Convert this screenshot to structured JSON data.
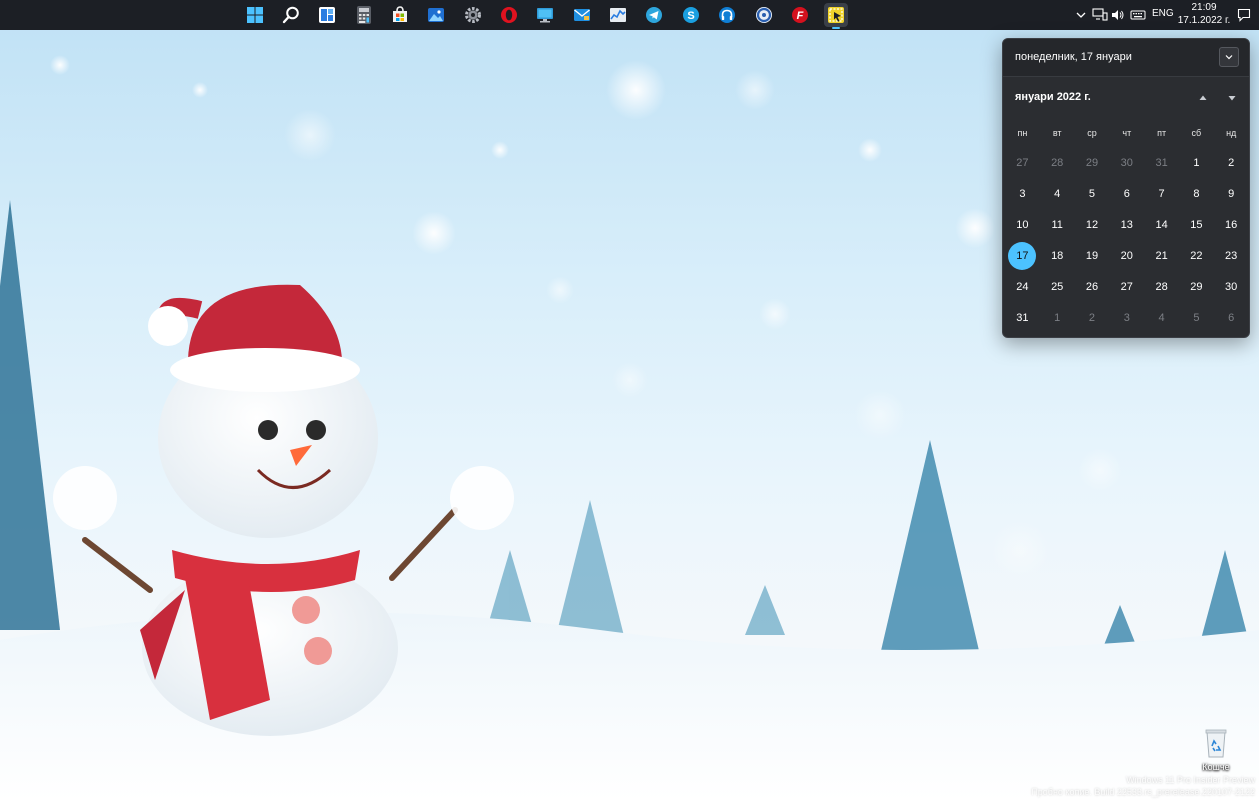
{
  "taskbar": {
    "apps": [
      {
        "icon": "windows-start-icon"
      },
      {
        "icon": "search-icon"
      },
      {
        "icon": "widgets-icon"
      },
      {
        "icon": "calculator-icon"
      },
      {
        "icon": "microsoft-store-icon"
      },
      {
        "icon": "photos-icon"
      },
      {
        "icon": "settings-gear-icon"
      },
      {
        "icon": "opera-browser-icon"
      },
      {
        "icon": "remote-desktop-icon"
      },
      {
        "icon": "mail-icon"
      },
      {
        "icon": "performance-monitor-icon"
      },
      {
        "icon": "telegram-icon"
      },
      {
        "icon": "skype-icon"
      },
      {
        "icon": "headphones-app-icon"
      },
      {
        "icon": "disc-app-icon"
      },
      {
        "icon": "filezilla-icon"
      },
      {
        "icon": "snipping-tool-icon"
      }
    ],
    "tray": {
      "language": "ENG",
      "time": "21:09",
      "date": "17.1.2022 г."
    }
  },
  "calendar": {
    "header_date": "понеделник, 17 януари",
    "month_label": "януари 2022 г.",
    "weekdays": [
      "пн",
      "вт",
      "ср",
      "чт",
      "пт",
      "сб",
      "нд"
    ],
    "weeks": [
      [
        "27",
        "28",
        "29",
        "30",
        "31",
        "1",
        "2"
      ],
      [
        "3",
        "4",
        "5",
        "6",
        "7",
        "8",
        "9"
      ],
      [
        "10",
        "11",
        "12",
        "13",
        "14",
        "15",
        "16"
      ],
      [
        "17",
        "18",
        "19",
        "20",
        "21",
        "22",
        "23"
      ],
      [
        "24",
        "25",
        "26",
        "27",
        "28",
        "29",
        "30"
      ],
      [
        "31",
        "1",
        "2",
        "3",
        "4",
        "5",
        "6"
      ]
    ],
    "today": "17",
    "accent_color": "#4cc2ff"
  },
  "desktop": {
    "recycle_bin_label": "Кошче",
    "watermark_line1": "Windows 11 Pro Insider Preview",
    "watermark_line2": "Пробно копие. Build 22533.rs_prerelease.220107-2122"
  }
}
